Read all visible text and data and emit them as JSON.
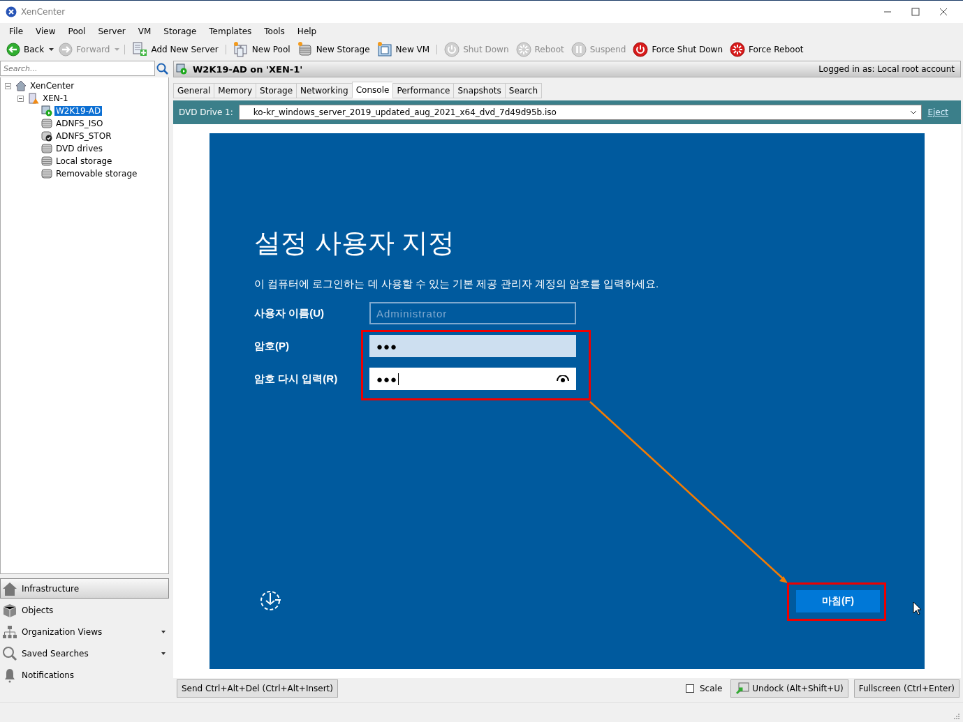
{
  "window": {
    "title": "XenCenter"
  },
  "menu": [
    "File",
    "View",
    "Pool",
    "Server",
    "VM",
    "Storage",
    "Templates",
    "Tools",
    "Help"
  ],
  "toolbar": [
    {
      "kind": "back",
      "label": "Back",
      "disabled": false,
      "dropdown": true
    },
    {
      "kind": "forward",
      "label": "Forward",
      "disabled": true,
      "dropdown": true
    },
    {
      "kind": "add-server",
      "label": "Add New Server",
      "disabled": false,
      "dropdown": false
    },
    {
      "kind": "new-pool",
      "label": "New Pool",
      "disabled": false,
      "dropdown": false
    },
    {
      "kind": "new-storage",
      "label": "New Storage",
      "disabled": false,
      "dropdown": false
    },
    {
      "kind": "new-vm",
      "label": "New VM",
      "disabled": false,
      "dropdown": false
    },
    {
      "kind": "shutdown",
      "label": "Shut Down",
      "disabled": true,
      "dropdown": false
    },
    {
      "kind": "reboot",
      "label": "Reboot",
      "disabled": true,
      "dropdown": false
    },
    {
      "kind": "suspend",
      "label": "Suspend",
      "disabled": true,
      "dropdown": false
    },
    {
      "kind": "force-shutdown",
      "label": "Force Shut Down",
      "disabled": false,
      "dropdown": false
    },
    {
      "kind": "force-reboot",
      "label": "Force Reboot",
      "disabled": false,
      "dropdown": false
    }
  ],
  "search": {
    "placeholder": "Search..."
  },
  "tree": [
    {
      "kind": "home",
      "label": "XenCenter",
      "expanded": true,
      "selected": false,
      "children": [
        {
          "kind": "server",
          "label": "XEN-1",
          "expanded": true,
          "selected": false,
          "children": [
            {
              "kind": "vm",
              "label": "W2K19-AD",
              "selected": true
            },
            {
              "kind": "storage",
              "label": "ADNFS_ISO",
              "selected": false
            },
            {
              "kind": "storage-default",
              "label": "ADNFS_STOR",
              "selected": false
            },
            {
              "kind": "storage",
              "label": "DVD drives",
              "selected": false
            },
            {
              "kind": "storage",
              "label": "Local storage",
              "selected": false
            },
            {
              "kind": "storage",
              "label": "Removable storage",
              "selected": false
            }
          ]
        }
      ]
    }
  ],
  "nav": [
    {
      "kind": "infrastructure",
      "label": "Infrastructure",
      "selected": true,
      "dropdown": false
    },
    {
      "kind": "objects",
      "label": "Objects",
      "selected": false,
      "dropdown": false
    },
    {
      "kind": "organization",
      "label": "Organization Views",
      "selected": false,
      "dropdown": true
    },
    {
      "kind": "searches",
      "label": "Saved Searches",
      "selected": false,
      "dropdown": true
    },
    {
      "kind": "notifications",
      "label": "Notifications",
      "selected": false,
      "dropdown": false
    }
  ],
  "header": {
    "title": "W2K19-AD on 'XEN-1'",
    "login": "Logged in as: Local root account"
  },
  "tabs": [
    {
      "label": "General",
      "selected": false
    },
    {
      "label": "Memory",
      "selected": false
    },
    {
      "label": "Storage",
      "selected": false
    },
    {
      "label": "Networking",
      "selected": false
    },
    {
      "label": "Console",
      "selected": true
    },
    {
      "label": "Performance",
      "selected": false
    },
    {
      "label": "Snapshots",
      "selected": false
    },
    {
      "label": "Search",
      "selected": false
    }
  ],
  "dvd": {
    "label": "DVD Drive 1:",
    "value": "ko-kr_windows_server_2019_updated_aug_2021_x64_dvd_7d49d95b.iso",
    "link": "Eject"
  },
  "console": {
    "title": "설정 사용자 지정",
    "description": "이 컴퓨터에 로그인하는 데 사용할 수 있는 기본 제공 관리자 계정의 암호를 입력하세요.",
    "fields": [
      {
        "kind": "text",
        "label": "사용자 이름(U)",
        "placeholder": "Administrator",
        "disabled": true,
        "focused": false
      },
      {
        "kind": "password",
        "label": "암호(P)",
        "value": "●●●",
        "disabled": false,
        "focused": false
      },
      {
        "kind": "password",
        "label": "암호 다시 입력(R)",
        "value": "●●●",
        "disabled": false,
        "focused": true
      }
    ],
    "button": "마침(F)"
  },
  "bottom": {
    "send": "Send Ctrl+Alt+Del (Ctrl+Alt+Insert)",
    "scale": {
      "label": "Scale",
      "checked": false
    },
    "undock": "Undock (Alt+Shift+U)",
    "fullscreen": "Fullscreen (Ctrl+Enter)"
  }
}
